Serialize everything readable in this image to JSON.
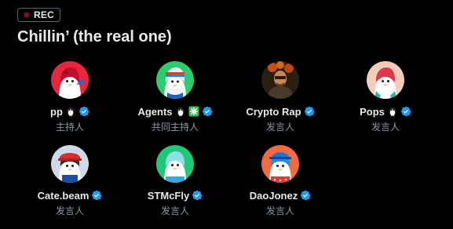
{
  "recording": {
    "label": "REC",
    "dot_color": "#7a1420"
  },
  "space": {
    "title": "Chillin’ (the real one)"
  },
  "colors": {
    "verified": "#1d9bf0",
    "name_text": "#e7e9ea",
    "role_text": "#8b98a5",
    "background": "#000000"
  },
  "speakers": [
    {
      "name": "pp",
      "role": "主持人",
      "avatar": "penguin-avatar-red",
      "avatar_bg": "#e8273f",
      "badges": [
        "penguin-icon",
        "verified-badge-icon"
      ]
    },
    {
      "name": "Agents",
      "role": "共同主持人",
      "avatar": "penguin-avatar-headband",
      "avatar_bg": "#2ecc71",
      "badges": [
        "penguin-icon",
        "asterisk-icon",
        "verified-badge-icon"
      ]
    },
    {
      "name": "Crypto Rap",
      "role": "发言人",
      "avatar": "person-photo-avatar",
      "avatar_bg": "#3a2a18",
      "badges": [
        "verified-badge-icon"
      ]
    },
    {
      "name": "Pops",
      "role": "发言人",
      "avatar": "penguin-avatar-pink",
      "avatar_bg": "#f3cdb9",
      "badges": [
        "penguin-icon",
        "verified-badge-icon"
      ]
    },
    {
      "name": "Cate.beam",
      "role": "发言人",
      "avatar": "penguin-avatar-cap",
      "avatar_bg": "#cfd8e6",
      "badges": [
        "verified-badge-icon"
      ]
    },
    {
      "name": "STMcFly",
      "role": "发言人",
      "avatar": "penguin-avatar-mint",
      "avatar_bg": "#1fc877",
      "badges": [
        "verified-badge-icon"
      ]
    },
    {
      "name": "DaoJonez",
      "role": "发言人",
      "avatar": "penguin-avatar-hat",
      "avatar_bg": "#f26a3d",
      "badges": [
        "verified-badge-icon"
      ]
    }
  ]
}
